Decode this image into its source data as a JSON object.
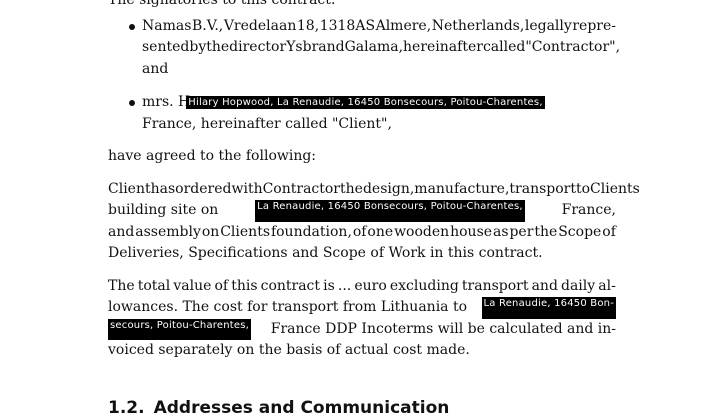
{
  "intro": "The signatories to this contract:",
  "signatories": [
    {
      "line1_words": [
        "Namas",
        "B.V.,",
        "Vredelaan",
        "18,",
        "1318AS",
        "Almere,",
        "Netherlands,",
        "legally",
        "repre-"
      ],
      "line2_words": [
        "sented",
        "by",
        "the",
        "director",
        "Ysbrand",
        "Galama,",
        "hereinafter",
        "called",
        "\"Contractor\","
      ],
      "line3": "and"
    },
    {
      "prefix": "mrs. H",
      "redacted_text": "Hilary Hopwood, La Renaudie, 16450 Bonsecours, Poitou-Charentes,",
      "line2": "France, hereinafter called \"Client\","
    }
  ],
  "agreed": "have agreed to the following:",
  "order_paragraph": {
    "line1_words": [
      "Client",
      "has",
      "ordered",
      "with",
      "Contractor",
      "the",
      "design,",
      "manufacture,",
      "transport",
      "to",
      "Clients"
    ],
    "line2_before": "building site on",
    "line2_redacted": "La Renaudie, 16450 Bonsecours, Poitou-Charentes,",
    "line2_after": "France,",
    "line3_words": [
      "and",
      "assembly",
      "on",
      "Clients",
      "foundation,",
      "of",
      "one",
      "wooden",
      "house",
      "as",
      "per",
      "the",
      "Scope",
      "of"
    ],
    "line4": "Deliveries, Specifications and Scope of Work in this contract."
  },
  "value_paragraph": {
    "line1_words": [
      "The",
      "total",
      "value",
      "of",
      "this",
      "contract",
      "is",
      "...",
      "euro",
      "excluding",
      "transport",
      "and",
      "daily",
      "al-"
    ],
    "line2_before": "lowances.  The cost for transport from Lithuania to",
    "line2_redacted": "La Renaudie, 16450 Bon-",
    "line3_redacted": "secours, Poitou-Charentes,",
    "line3_after": "France DDP Incoterms will be calculated and in-",
    "line4": "voiced separately on the basis of actual cost made."
  },
  "section": {
    "number": "1.2.",
    "title": "Addresses and Communication"
  }
}
